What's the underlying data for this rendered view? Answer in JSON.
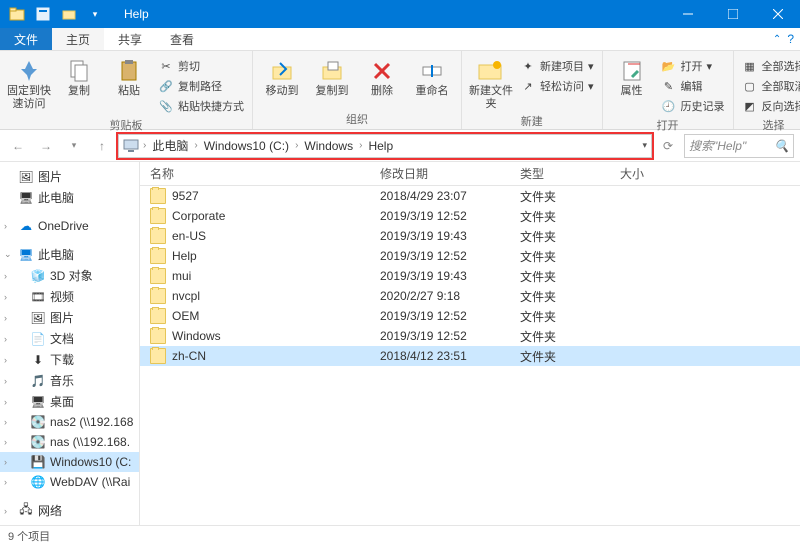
{
  "window_title": "Help",
  "tabs": {
    "file": "文件",
    "home": "主页",
    "share": "共享",
    "view": "查看"
  },
  "ribbon": {
    "clipboard": {
      "label": "剪贴板",
      "pin": "固定到快速访问",
      "copy": "复制",
      "paste": "粘贴",
      "cut": "剪切",
      "copypath": "复制路径",
      "shortcut": "粘贴快捷方式"
    },
    "organize": {
      "label": "组织",
      "move": "移动到",
      "copy": "复制到",
      "delete": "删除",
      "rename": "重命名"
    },
    "new": {
      "label": "新建",
      "folder": "新建文件夹",
      "newitem": "新建项目",
      "easyaccess": "轻松访问"
    },
    "open": {
      "label": "打开",
      "props": "属性",
      "openbtn": "打开",
      "edit": "编辑",
      "history": "历史记录"
    },
    "select": {
      "label": "选择",
      "all": "全部选择",
      "none": "全部取消",
      "invert": "反向选择"
    }
  },
  "path": [
    "此电脑",
    "Windows10 (C:)",
    "Windows",
    "Help"
  ],
  "search_placeholder": "搜索\"Help\"",
  "columns": {
    "name": "名称",
    "date": "修改日期",
    "type": "类型",
    "size": "大小"
  },
  "nav": {
    "pictures": "图片",
    "thispc": "此电脑",
    "onedrive": "OneDrive",
    "thispc2": "此电脑",
    "obj3d": "3D 对象",
    "videos": "视频",
    "pics": "图片",
    "docs": "文档",
    "downloads": "下载",
    "music": "音乐",
    "desktop": "桌面",
    "nas2": "nas2 (\\\\192.168",
    "nas": "nas (\\\\192.168.",
    "cdrive": "Windows10 (C:",
    "webdav": "WebDAV (\\\\Rai",
    "network": "网络"
  },
  "items": [
    {
      "name": "9527",
      "date": "2018/4/29 23:07",
      "type": "文件夹"
    },
    {
      "name": "Corporate",
      "date": "2019/3/19 12:52",
      "type": "文件夹"
    },
    {
      "name": "en-US",
      "date": "2019/3/19 19:43",
      "type": "文件夹"
    },
    {
      "name": "Help",
      "date": "2019/3/19 12:52",
      "type": "文件夹"
    },
    {
      "name": "mui",
      "date": "2019/3/19 19:43",
      "type": "文件夹"
    },
    {
      "name": "nvcpl",
      "date": "2020/2/27 9:18",
      "type": "文件夹"
    },
    {
      "name": "OEM",
      "date": "2019/3/19 12:52",
      "type": "文件夹"
    },
    {
      "name": "Windows",
      "date": "2019/3/19 12:52",
      "type": "文件夹"
    },
    {
      "name": "zh-CN",
      "date": "2018/4/12 23:51",
      "type": "文件夹"
    }
  ],
  "status": "9 个项目"
}
